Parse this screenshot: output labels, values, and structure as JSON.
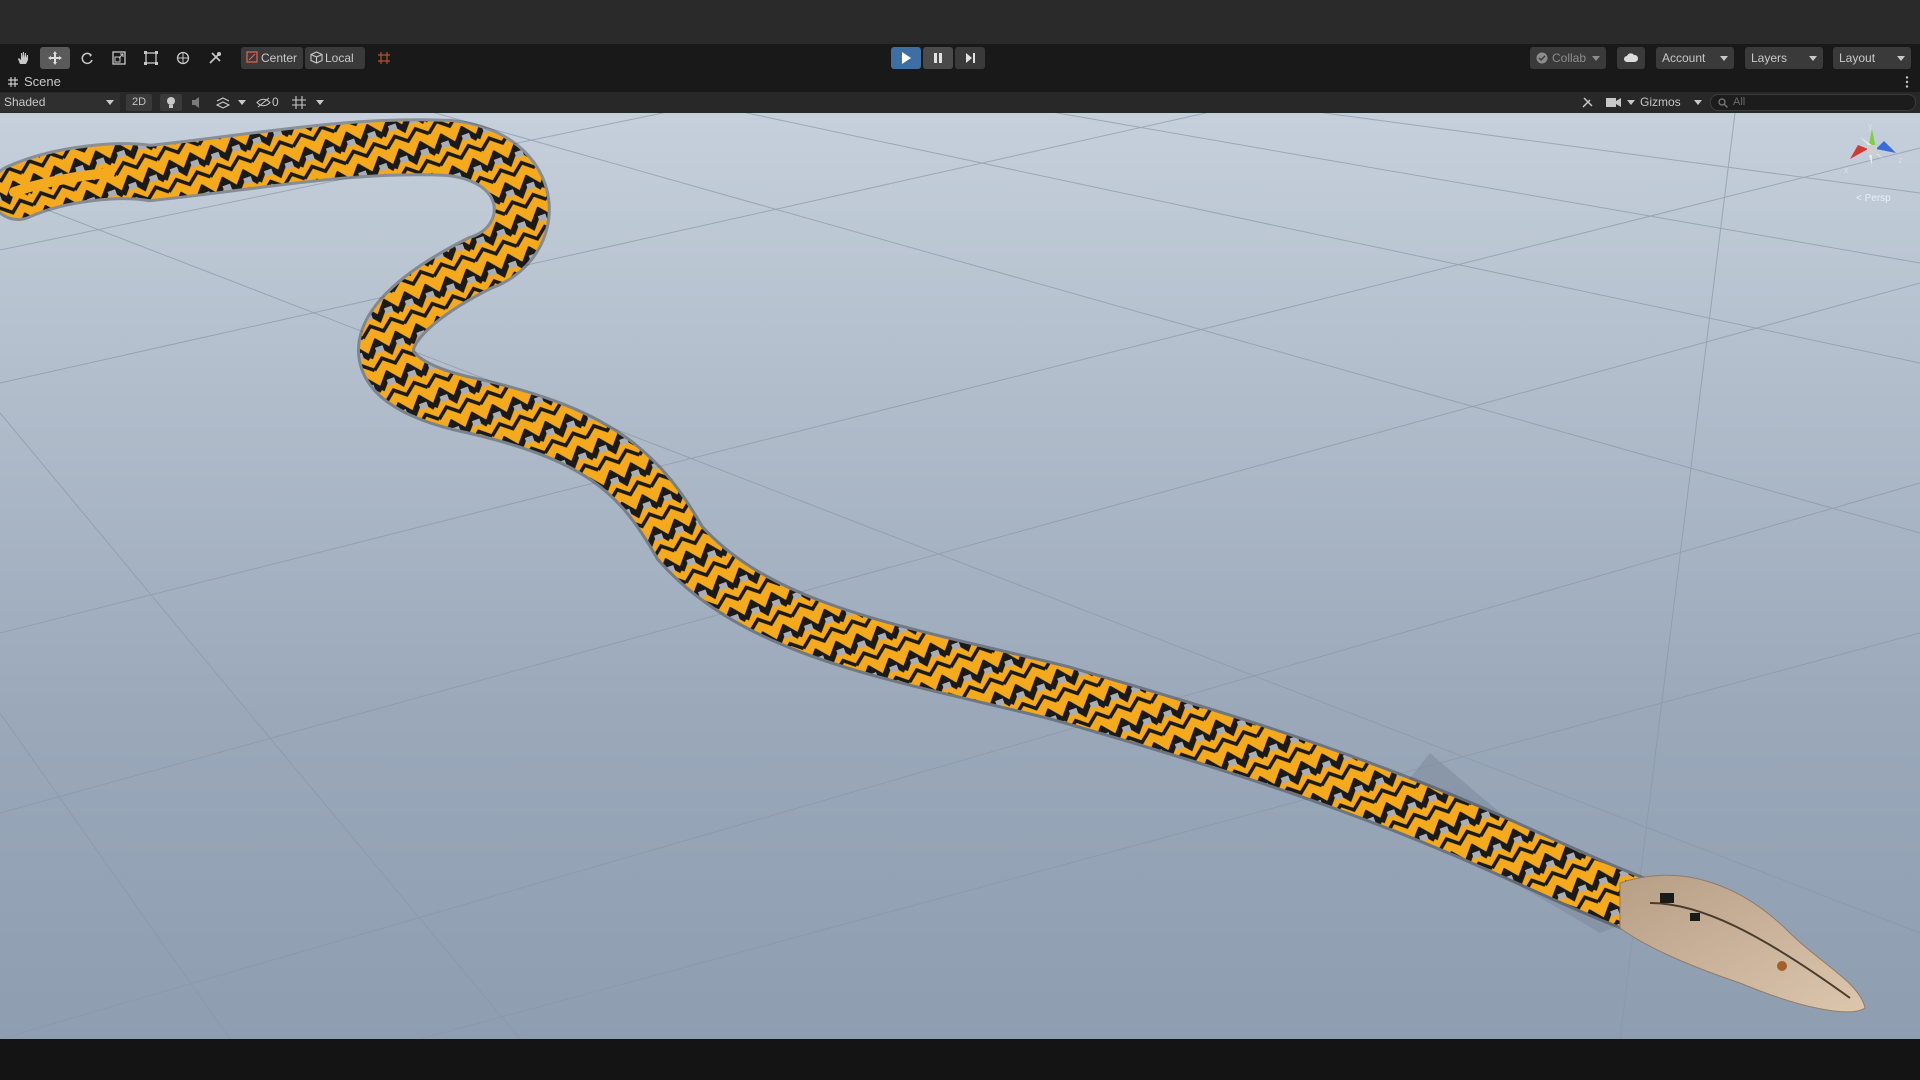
{
  "toolbar": {
    "tools": [
      {
        "name": "hand-tool",
        "icon": "hand-icon"
      },
      {
        "name": "move-tool",
        "icon": "move-icon",
        "selected": true
      },
      {
        "name": "rotate-tool",
        "icon": "rotate-icon"
      },
      {
        "name": "scale-tool",
        "icon": "scale-icon"
      },
      {
        "name": "rect-tool",
        "icon": "rect-icon"
      },
      {
        "name": "transform-tool",
        "icon": "transform-icon"
      },
      {
        "name": "custom-tool",
        "icon": "tools-icon"
      }
    ],
    "pivot_mode_label": "Center",
    "pivot_rotation_label": "Local",
    "collab_label": "Collab",
    "account_label": "Account",
    "layers_label": "Layers",
    "layout_label": "Layout"
  },
  "scene_window": {
    "tab_label": "Scene",
    "draw_mode": "Shaded",
    "mode_2d_label": "2D",
    "hidden_count": "0",
    "gizmos_label": "Gizmos",
    "search_placeholder": "All",
    "view_mode_label": "Persp"
  },
  "gizmo": {
    "axis_y": "y",
    "axis_x": "x",
    "axis_z": "z",
    "colors": {
      "x": "#d23a30",
      "y": "#7fd13b",
      "z": "#3a6cd8"
    }
  },
  "colors": {
    "accent_play": "#3d6fa5",
    "snake_yellow": "#f5a91c",
    "snake_black": "#1a1a1a",
    "snake_gray": "#a9aeb6",
    "snake_head": "#cdb49a"
  }
}
